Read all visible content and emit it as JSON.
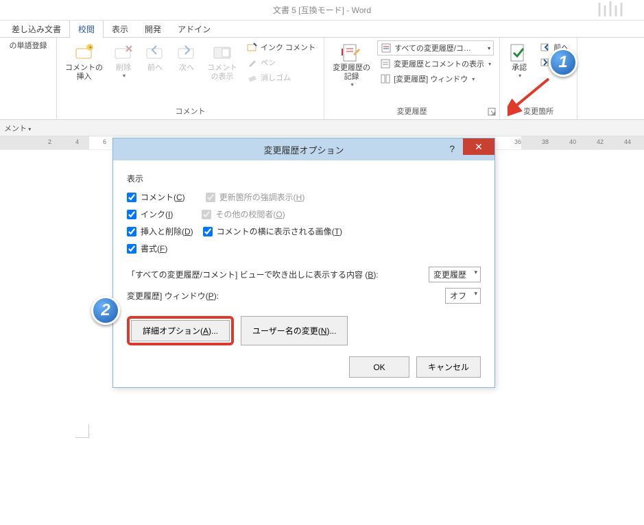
{
  "title": "文書 5 [互換モード] - Word",
  "tabs": {
    "mailings": "差し込み文書",
    "review": "校閲",
    "view": "表示",
    "developer": "開発",
    "addins": "アドイン"
  },
  "ribbon": {
    "wordreg": "の単語登録",
    "comment_insert": "コメントの\n挿入",
    "delete": "削除",
    "prev": "前へ",
    "next": "次へ",
    "show_comments": "コメント\nの表示",
    "ink_comment": "インク コメント",
    "pen": "ペン",
    "eraser": "消しゴム",
    "group_comment": "コメント",
    "track_changes": "変更履歴の\n記録",
    "display_for_review": "すべての変更履歴/コ…",
    "show_markup": "変更履歴とコメントの表示",
    "reviewing_pane": "[変更履歴] ウィンドウ",
    "group_tracking": "変更履歴",
    "accept": "承認",
    "changes_prev": "前へ",
    "changes_next": "次へ",
    "group_changes": "変更箇所"
  },
  "subtoolbar": {
    "label": "メント"
  },
  "dialog": {
    "title": "変更履歴オプション",
    "section_show": "表示",
    "chk_comments": "コメント(C)",
    "chk_highlight": "更新箇所の強調表示(H)",
    "chk_ink": "インク(I)",
    "chk_other_authors": "その他の校閲者(O)",
    "chk_insdel": "挿入と削除(D)",
    "chk_pictures": "コメントの横に表示される画像(T)",
    "chk_format": "書式(F)",
    "balloon_label": "「すべての変更履歴/コメント] ビューで吹き出しに表示する内容 (B):",
    "balloon_value": "変更履歴",
    "reviewpane_label": "変更履歴] ウィンドウ(P):",
    "reviewpane_value": "オフ",
    "btn_advanced": "詳細オプション(A)...",
    "btn_username": "ユーザー名の変更(N)...",
    "btn_ok": "OK",
    "btn_cancel": "キャンセル"
  }
}
